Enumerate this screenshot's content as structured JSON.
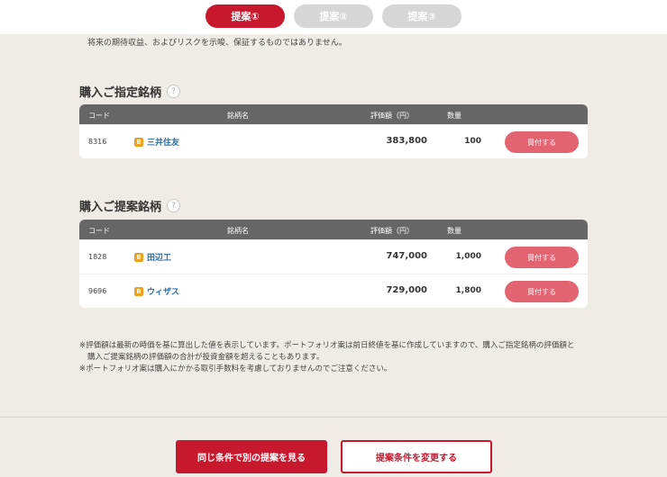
{
  "tabs": [
    {
      "label": "提案①",
      "active": true
    },
    {
      "label": "提案②",
      "active": false
    },
    {
      "label": "提案③",
      "active": false
    }
  ],
  "disclaimer_top": "将来の期待収益、およびリスクを示唆、保証するものではありません。",
  "columns": {
    "code": "コード",
    "name": "銘柄名",
    "value": "評価額（円）",
    "qty": "数量"
  },
  "designated": {
    "title": "購入ご指定銘柄",
    "help": "?",
    "rows": [
      {
        "code": "8316",
        "badge": "B",
        "name": "三井住友",
        "value": "383,800",
        "qty": "100",
        "buy": "買付する"
      }
    ]
  },
  "proposed": {
    "title": "購入ご提案銘柄",
    "help": "?",
    "rows": [
      {
        "code": "1828",
        "badge": "B",
        "name": "田辺工",
        "value": "747,000",
        "qty": "1,000",
        "buy": "買付する"
      },
      {
        "code": "9696",
        "badge": "B",
        "name": "ウィザス",
        "value": "729,000",
        "qty": "1,800",
        "buy": "買付する"
      }
    ]
  },
  "notes": {
    "line1": "※評価額は最新の時価を基に算出した値を表示しています。ポートフォリオ案は前日終値を基に作成していますので、購入ご指定銘柄の評価額と",
    "line2": "購入ご提案銘柄の評価額の合計が投資金額を超えることもあります。",
    "line3": "※ポートフォリオ案は購入にかかる取引手数料を考慮しておりませんのでご注意ください。"
  },
  "footer": {
    "primary": "同じ条件で別の提案を見る",
    "secondary": "提案条件を変更する"
  },
  "colors": {
    "accent": "#c8182e",
    "buy": "#e26470",
    "header": "#666666",
    "background": "#efebe6"
  }
}
